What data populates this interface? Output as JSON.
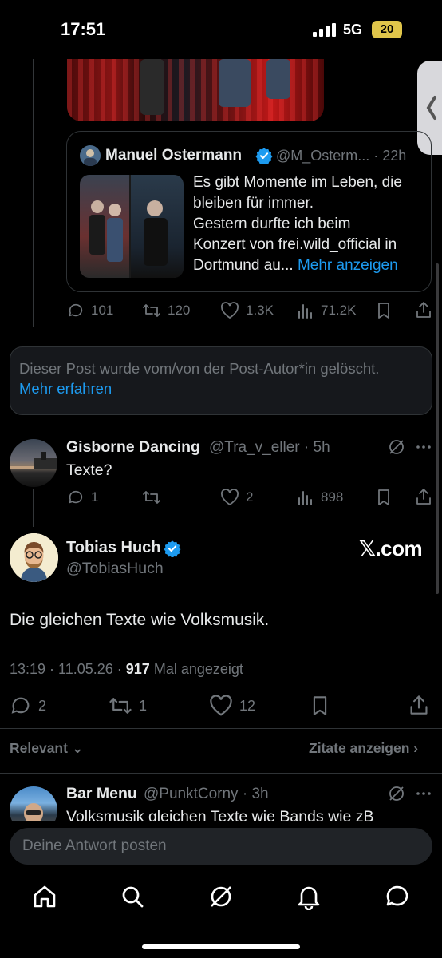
{
  "status_bar": {
    "time": "17:51",
    "network": "5G",
    "battery": "20"
  },
  "quote": {
    "author_name": "Manuel Ostermann",
    "author_handle": "@M_Osterm...",
    "age": "22h",
    "text_lines": [
      "Es gibt Momente im Leben, die",
      "bleiben für immer.",
      "Gestern durfte ich beim",
      "Konzert von frei.wild_official in"
    ],
    "text_last": "Dortmund au...",
    "more_link": "Mehr anzeigen"
  },
  "post1_actions": {
    "replies": "101",
    "reposts": "120",
    "likes": "1.3K",
    "views": "71.2K"
  },
  "deleted": {
    "text": "Dieser Post wurde vom/von der Post-Autor*in gelöscht.",
    "link": "Mehr erfahren"
  },
  "reply_gisborne": {
    "name": "Gisborne Dancing",
    "handle": "@Tra_v_eller · 5h",
    "text": "Texte?",
    "replies": "1",
    "likes": "2",
    "views": "898"
  },
  "main_post": {
    "name": "Tobias Huch",
    "handle": "@TobiasHuch",
    "brand": "𝕏.com",
    "text": "Die gleichen Texte wie Volksmusik.",
    "time": "13:19 · 11.05.26 · ",
    "views": "917",
    "views_label": " Mal angezeigt",
    "replies": "2",
    "reposts": "1",
    "likes": "12"
  },
  "sort": {
    "relevant": "Relevant",
    "quotes_link": "Zitate anzeigen"
  },
  "reply_barmenu": {
    "name": "Bar Menu",
    "handle": "@PunktCorny · 3h",
    "text": "Volksmusik gleichen Texte wie Bands wie zB"
  },
  "reply_box": {
    "placeholder": "Deine Antwort posten"
  },
  "colors": {
    "accent": "#1d9bf0",
    "background": "#000000",
    "muted": "#71767b"
  }
}
